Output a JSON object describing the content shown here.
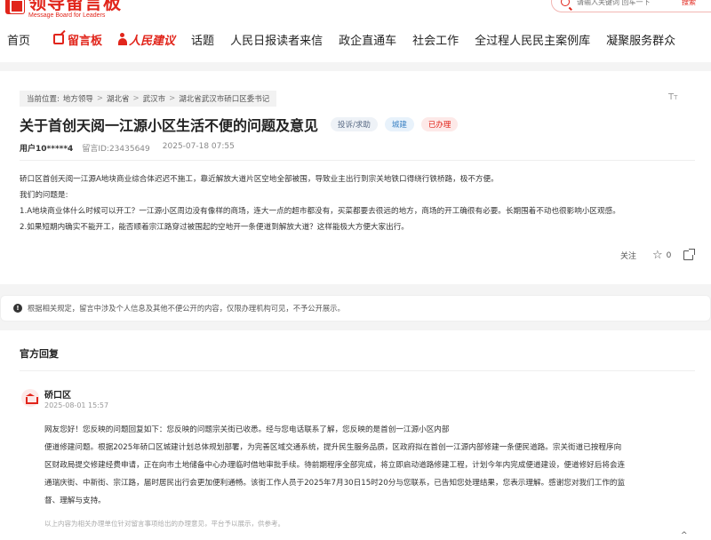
{
  "header": {
    "logo_title": "领导留言板",
    "logo_subtitle": "Message Board for Leaders",
    "search_placeholder": "请输入关键词 回车一下",
    "search_button": "搜索"
  },
  "nav": {
    "items": [
      {
        "label": "首页"
      },
      {
        "label": "留言板"
      },
      {
        "label": "人民建议"
      },
      {
        "label": "话题"
      },
      {
        "label": "人民日报读者来信"
      },
      {
        "label": "政企直通车"
      },
      {
        "label": "社会工作"
      },
      {
        "label": "全过程人民民主案例库"
      },
      {
        "label": "凝聚服务群众"
      }
    ]
  },
  "breadcrumb": {
    "prefix": "当前位置:",
    "items": [
      "地方领导",
      "湖北省",
      "武汉市",
      "湖北省武汉市硚口区委书记"
    ],
    "separator": ">"
  },
  "message": {
    "title": "关于首创天阅一江源小区生活不便的问题及意见",
    "tag_type": "投诉/求助",
    "tag_field": "城建",
    "tag_status": "已办理",
    "user": "用户10*****4",
    "message_id": "留言ID:23435649",
    "time": "2025-07-18 07:55",
    "paragraphs": [
      "硚口区首创天阅一江源A地块商业综合体迟迟不施工，靠近解放大道片区空地全部被围，导致业主出行到宗关地铁口得绕行铁桥路，极不方便。",
      "我们的问题是:",
      "1.A地块商业体什么时候可以开工？一江源小区周边没有像样的商场，连大一点的超市都没有，买菜都要去很远的地方，商场的开工确很有必要。长期围着不动也很影响小区观感。",
      "2.如果短期内确实不能开工，能否顺着宗江路穿过被围起的空地开一条便道到解放大道？这样能极大方便大家出行。"
    ],
    "follow_label": "关注",
    "star_count": "0"
  },
  "notice": {
    "text": "根据相关规定，留言中涉及个人信息及其他不便公开的内容，仅限办理机构可见，不予公开展示。"
  },
  "reply": {
    "heading": "官方回复",
    "org_name": "硚口区",
    "time": "2025-08-01 15:57",
    "lines": [
      "网友您好！您反映的问题回复如下：您反映的问题宗关街已收悉。经与您电话联系了解，您反映的是首创一江源小区内部",
      "便道修建问题。根据2025年硚口区城建计划总体规划部署，为完善区域交通系统，提升民生服务品质，区政府拟在首创一江源内部修建一条便民道路。宗关街道已按程序向",
      "区财政局提交修建经费申请，正在向市土地储备中心办理临时借地审批手续。待前期程序全部完成，将立即启动道路修建工程，计划今年内完成便道建设，便道修好后将会连",
      "通瑞庆街、中新街、宗江路，届时居民出行会更加便利通畅。该街工作人员于2025年7月30日15时20分与您联系，已告知您处理结果，您表示理解。感谢您对我们工作的监",
      "督、理解与支持。"
    ],
    "footnote": "以上内容为相关办理单位针对留言事项给出的办理意见，平台予以展示，供参考。"
  }
}
